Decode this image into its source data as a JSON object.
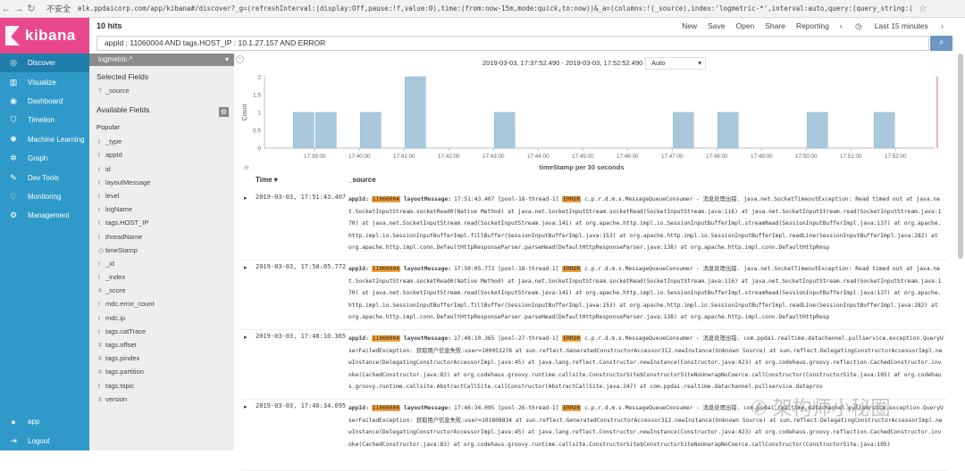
{
  "browser": {
    "insecure_label": "不安全",
    "url": "elk.ppdaicorp.com/app/kibana#/discover?_g=(refreshInterval:(display:Off,pause:!f,value:0),time:(from:now-15m,mode:quick,to:now))&_a=(columns:!(_source),index:'logmetric-*',interval:auto,query:(query_string:(analyze_wildcard:!t,query:'"
  },
  "app": {
    "logo_text": "kibana",
    "brand_color": "#e8488b",
    "sidebar_color": "#2f9ac9"
  },
  "sidebar": {
    "items": [
      {
        "label": "Discover",
        "icon": "compass-icon",
        "glyph": "◎"
      },
      {
        "label": "Visualize",
        "icon": "bar-chart-icon",
        "glyph": "▥"
      },
      {
        "label": "Dashboard",
        "icon": "dashboard-icon",
        "glyph": "◉"
      },
      {
        "label": "Timelion",
        "icon": "shield-icon",
        "glyph": "⛉"
      },
      {
        "label": "Machine Learning",
        "icon": "brain-icon",
        "glyph": "✺"
      },
      {
        "label": "Graph",
        "icon": "graph-icon",
        "glyph": "✲"
      },
      {
        "label": "Dev Tools",
        "icon": "wrench-icon",
        "glyph": "✎"
      },
      {
        "label": "Monitoring",
        "icon": "heartbeat-icon",
        "glyph": "♡"
      },
      {
        "label": "Management",
        "icon": "gear-icon",
        "glyph": "⚙"
      }
    ],
    "bottom": [
      {
        "label": "app",
        "icon": "user-icon",
        "glyph": "●"
      },
      {
        "label": "Logout",
        "icon": "logout-icon",
        "glyph": "⇥"
      }
    ]
  },
  "topbar": {
    "hits": "10 hits",
    "menu": [
      "New",
      "Save",
      "Open",
      "Share",
      "Reporting"
    ],
    "time_picker": "Last 15 minutes"
  },
  "search": {
    "query": "appId : 11060004 AND tags.HOST_IP : 10.1.27.157 AND ERROR",
    "button_icon": "search-icon"
  },
  "fields": {
    "index": "logmetric-*",
    "selected_title": "Selected Fields",
    "selected": [
      {
        "type": "?",
        "name": "_source"
      }
    ],
    "available_title": "Available Fields",
    "popular_title": "Popular",
    "popular": [
      {
        "type": "t",
        "name": "_type"
      },
      {
        "type": "t",
        "name": "appId"
      },
      {
        "type": "t",
        "name": "id"
      },
      {
        "type": "t",
        "name": "layoutMessage"
      },
      {
        "type": "t",
        "name": "level"
      },
      {
        "type": "t",
        "name": "logName"
      },
      {
        "type": "t",
        "name": "tags.HOST_IP"
      },
      {
        "type": "t",
        "name": "threadName"
      },
      {
        "type": "◷",
        "name": "timeStamp"
      }
    ],
    "others": [
      {
        "type": "t",
        "name": "_id"
      },
      {
        "type": "t",
        "name": "_index"
      },
      {
        "type": "#",
        "name": "_score"
      },
      {
        "type": "t",
        "name": "mdc.error_count"
      },
      {
        "type": "t",
        "name": "mdc.ip"
      },
      {
        "type": "t",
        "name": "tags.catTrace"
      },
      {
        "type": "#",
        "name": "tags.offset"
      },
      {
        "type": "#",
        "name": "tags.pindex"
      },
      {
        "type": "#",
        "name": "tags.partition"
      },
      {
        "type": "t",
        "name": "tags.topic"
      },
      {
        "type": "#",
        "name": "version"
      }
    ]
  },
  "histogram": {
    "time_range": "2019-03-03, 17:37:52.490 - 2019-03-03, 17:52:52.490 —",
    "interval": "Auto"
  },
  "chart_data": {
    "type": "bar",
    "ylabel": "Count",
    "xlabel": "timeStamp per 30 seconds",
    "ylim": [
      0,
      2
    ],
    "yticks": [
      "0",
      "0.5",
      "1",
      "1.5",
      "2"
    ],
    "xticks": [
      "17:39:00",
      "17:40:00",
      "17:41:00",
      "17:42:00",
      "17:43:00",
      "17:44:00",
      "17:45:00",
      "17:46:00",
      "17:47:00",
      "17:48:00",
      "17:49:00",
      "17:50:00",
      "17:51:00",
      "17:52:00"
    ],
    "bars": [
      {
        "x": "17:38:30",
        "value": 1
      },
      {
        "x": "17:39:00",
        "value": 1
      },
      {
        "x": "17:40:00",
        "value": 1
      },
      {
        "x": "17:41:00",
        "value": 2
      },
      {
        "x": "17:43:00",
        "value": 1
      },
      {
        "x": "17:47:00",
        "value": 1
      },
      {
        "x": "17:48:00",
        "value": 1
      },
      {
        "x": "17:50:00",
        "value": 1
      },
      {
        "x": "17:51:30",
        "value": 1
      }
    ],
    "bar_color": "#aac8dc"
  },
  "table": {
    "col_time": "Time ▾",
    "col_source": "_source",
    "rows": [
      {
        "time": "2019-03-03, 17:51:43.407",
        "appId": "11060004",
        "msg_ts": "17:51:43.407",
        "thread": "[pool-18-thread-1]",
        "level": "ERROR",
        "text": "c.p.r.d.m.s.MessageQueueConsumer - 消息处理出错. java.net.SocketTimeoutException: Read timed out at java.net.SocketInputStream.socketRead0(Native Method) at java.net.SocketInputStream.socketRead(SocketInputStream.java:116) at java.net.SocketInputStream.read(SocketInputStream.java:170) at java.net.SocketInputStream.read(SocketInputStream.java:141) at org.apache.http.impl.io.SessionInputBufferImpl.streamRead(SessionInputBufferImpl.java:137) at org.apache.http.impl.io.SessionInputBufferImpl.fillBuffer(SessionInputBufferImpl.java:153) at org.apache.http.impl.io.SessionInputBufferImpl.readLine(SessionInputBufferImpl.java:282) at org.apache.http.impl.conn.DefaultHttpResponseParser.parseHead(DefaultHttpResponseParser.java:138) at org.apache.http.impl.conn.DefaultHttpResp"
      },
      {
        "time": "2019-03-03, 17:50:05.772",
        "appId": "11060004",
        "msg_ts": "17:50:05.772",
        "thread": "[pool-18-thread-1]",
        "level": "ERROR",
        "text": "c.p.r.d.m.s.MessageQueueConsumer - 消息处理出错. java.net.SocketTimeoutException: Read timed out at java.net.SocketInputStream.socketRead0(Native Method) at java.net.SocketInputStream.socketRead(SocketInputStream.java:116) at java.net.SocketInputStream.read(SocketInputStream.java:170) at java.net.SocketInputStream.read(SocketInputStream.java:141) at org.apache.http.impl.io.SessionInputBufferImpl.streamRead(SessionInputBufferImpl.java:137) at org.apache.http.impl.io.SessionInputBufferImpl.fillBuffer(SessionInputBufferImpl.java:153) at org.apache.http.impl.io.SessionInputBufferImpl.readLine(SessionInputBufferImpl.java:282) at org.apache.http.impl.conn.DefaultHttpResponseParser.parseHead(DefaultHttpResponseParser.java:138) at org.apache.http.impl.conn.DefaultHttpResp"
      },
      {
        "time": "2019-03-03, 17:48:10.365",
        "appId": "11060004",
        "msg_ts": "17:48:10.365",
        "thread": "[pool-27-thread-1]",
        "level": "ERROR",
        "text": "c.p.r.d.m.s.MessageQueueConsumer - 消息处理出错. com.ppdai.realtime.datachannel.pullservice.exception.QueryUserFailedException: 获取用户信息失败:user=100053278 at sun.reflect.GeneratedConstructorAccessor312.newInstance(Unknown Source) at sun.reflect.DelegatingConstructorAccessorImpl.newInstance(DelegatingConstructorAccessorImpl.java:45) at java.lang.reflect.Constructor.newInstance(Constructor.java:423) at org.codehaus.groovy.reflection.CachedConstructor.invoke(CachedConstructor.java:83) at org.codehaus.groovy.runtime.callsite.ConstructorSite$ConstructorSiteNoUnwrapNoCoerce.callConstructor(ConstructorSite.java:105) at org.codehaus.groovy.runtime.callsite.AbstractCallSite.callConstructor(AbstractCallSite.java:247) at com.ppdai.realtime.datachannel.pullservice.dataprov"
      },
      {
        "time": "2019-03-03, 17:46:34.095",
        "appId": "11060004",
        "msg_ts": "17:46:34.095",
        "thread": "[pool-26-thread-1]",
        "level": "ERROR",
        "text": "c.p.r.d.m.s.MessageQueueConsumer - 消息处理出错. com.ppdai.realtime.datachannel.pullservice.exception.QueryUserFailedException: 获取用户信息失败:user=101808834 at sun.reflect.GeneratedConstructorAccessor312.newInstance(Unknown Source) at sun.reflect.DelegatingConstructorAccessorImpl.newInstance(DelegatingConstructorAccessorImpl.java:45) at java.lang.reflect.Constructor.newInstance(Constructor.java:423) at org.codehaus.groovy.reflection.CachedConstructor.invoke(CachedConstructor.java:83) at org.codehaus.groovy.runtime.callsite.ConstructorSite$ConstructorSiteNoUnwrapNoCoerce.callConstructor(ConstructorSite.java:105)"
      }
    ],
    "key_appid": "appId:",
    "key_layout": "layoutMessage:"
  },
  "watermark": "✆ 架构师小秘圈"
}
